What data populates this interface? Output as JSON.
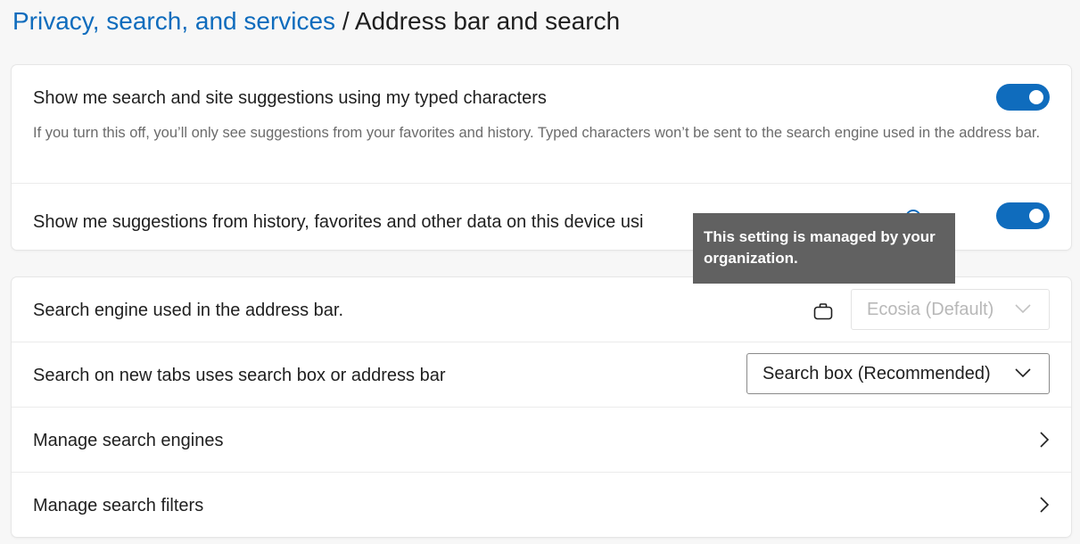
{
  "breadcrumb": {
    "parent": "Privacy, search, and services",
    "separator": " / ",
    "current": "Address bar and search"
  },
  "suggestions_card": {
    "typed_chars": {
      "title": "Show me search and site suggestions using my typed characters",
      "description": "If you turn this off, you’ll only see suggestions from your favorites and history. Typed characters won’t be sent to the search engine used in the address bar.",
      "toggle_on": true
    },
    "history_suggestions": {
      "title": "Show me suggestions from history, favorites and other data on this device usi",
      "toggle_on": true
    }
  },
  "tooltip": {
    "text": "This setting is managed by your organization."
  },
  "search_card": {
    "search_engine": {
      "title": "Search engine used in the address bar.",
      "value": "Ecosia (Default)",
      "disabled": true,
      "managed_icon": "briefcase-icon"
    },
    "new_tabs": {
      "title": "Search on new tabs uses search box or address bar",
      "value": "Search box (Recommended)"
    },
    "manage_engines": {
      "title": "Manage search engines"
    },
    "manage_filters": {
      "title": "Manage search filters"
    }
  },
  "colors": {
    "accent": "#0f6cbd",
    "tooltip_bg": "#616161",
    "page_bg": "#f7f7f7"
  }
}
